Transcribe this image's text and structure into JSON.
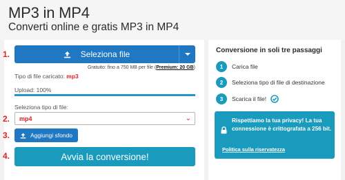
{
  "header": {
    "title": "MP3 in MP4",
    "subtitle": "Converti online e gratis MP3 in MP4"
  },
  "steps": {
    "n1": "1.",
    "n2": "2.",
    "n3": "3.",
    "n4": "4."
  },
  "upload": {
    "select_label": "Seleziona file",
    "limit_prefix": "Gratuito: fino a 750 MB per file (",
    "premium_label": "Premium: 20 GB",
    "limit_suffix": ")",
    "file_type_label": "Tipo di file caricato: ",
    "file_type_value": "mp3",
    "progress_label": "Upload: 100%",
    "progress_fraction": 1.0
  },
  "target": {
    "label": "Seleziona tipo di file:",
    "selected": "mp4"
  },
  "background_button": "Aggiungi sfondo",
  "convert_button": "Avvia la conversione!",
  "sidebar": {
    "title": "Conversione in soli tre passaggi",
    "steps": [
      {
        "num": "1",
        "text": "Carica file"
      },
      {
        "num": "2",
        "text": "Seleziona tipo di file di destinazione"
      },
      {
        "num": "3",
        "text": "Scarica il file!"
      }
    ],
    "privacy_text": "Rispettiamo la tua privacy! La tua connessione è crittografata a 256 bit.",
    "privacy_link": "Politica sulla riservatezza"
  },
  "colors": {
    "primary_blue": "#1f78c1",
    "teal": "#1a9bbd",
    "accent_red": "#dd2222"
  },
  "icons": {
    "upload": "upload-icon",
    "caret": "caret-down-icon",
    "chevron": "chevron-down-icon",
    "check": "check-circle-icon",
    "lock": "lock-icon"
  }
}
